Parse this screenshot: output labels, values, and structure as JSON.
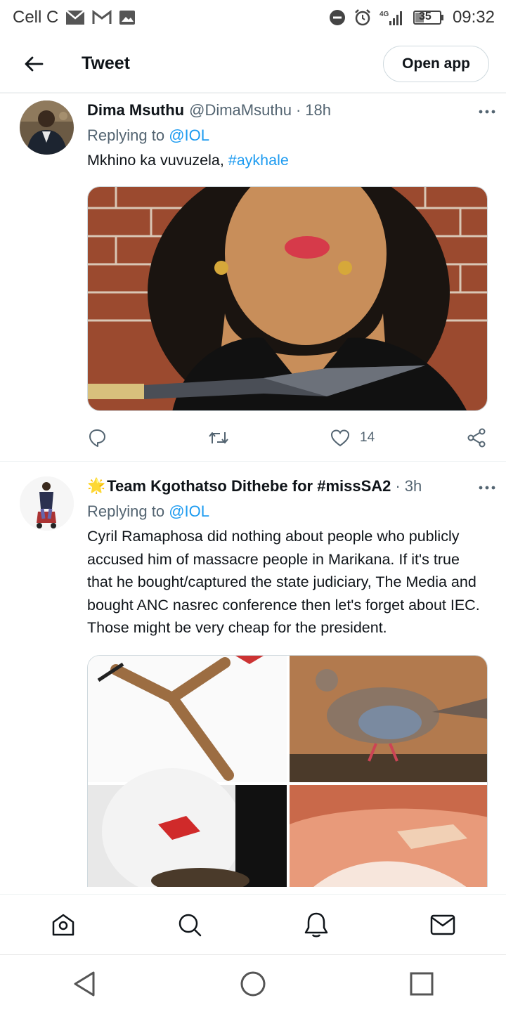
{
  "status_bar": {
    "carrier": "Cell C",
    "network": "4G",
    "battery": "35",
    "time": "09:32"
  },
  "header": {
    "title": "Tweet",
    "open_app_label": "Open app"
  },
  "tweets": [
    {
      "name": "Dima Msuthu",
      "handle": "@DimaMsuthu",
      "separator": "·",
      "time": "18h",
      "replying_prefix": "Replying to",
      "replying_to": "@IOL",
      "text_plain": "Mkhino ka vuvuzela, ",
      "hashtag": "#aykhale",
      "likes": "14"
    },
    {
      "emoji": "🌟",
      "name": "Team Kgothatso Dithebe for #missSA2",
      "separator": "·",
      "time": "3h",
      "replying_prefix": "Replying to",
      "replying_to": "@IOL",
      "text": "Cyril Ramaphosa did nothing about people who publicly accused him of massacre people in Marikana. If it's true that he bought/captured the state judiciary, The Media and bought ANC nasrec conference then let's forget about IEC. Those might be very cheap for the president."
    }
  ],
  "colors": {
    "accent": "#1d9bf0",
    "secondary_text": "#536471",
    "border": "#cfd9de"
  },
  "icons": {
    "back": "arrow-left-icon",
    "more": "more-horizontal-icon",
    "reply": "reply-icon",
    "retweet": "retweet-icon",
    "like": "heart-icon",
    "share": "share-icon",
    "home": "home-icon",
    "search": "search-icon",
    "notifications": "bell-icon",
    "messages": "mail-icon"
  }
}
